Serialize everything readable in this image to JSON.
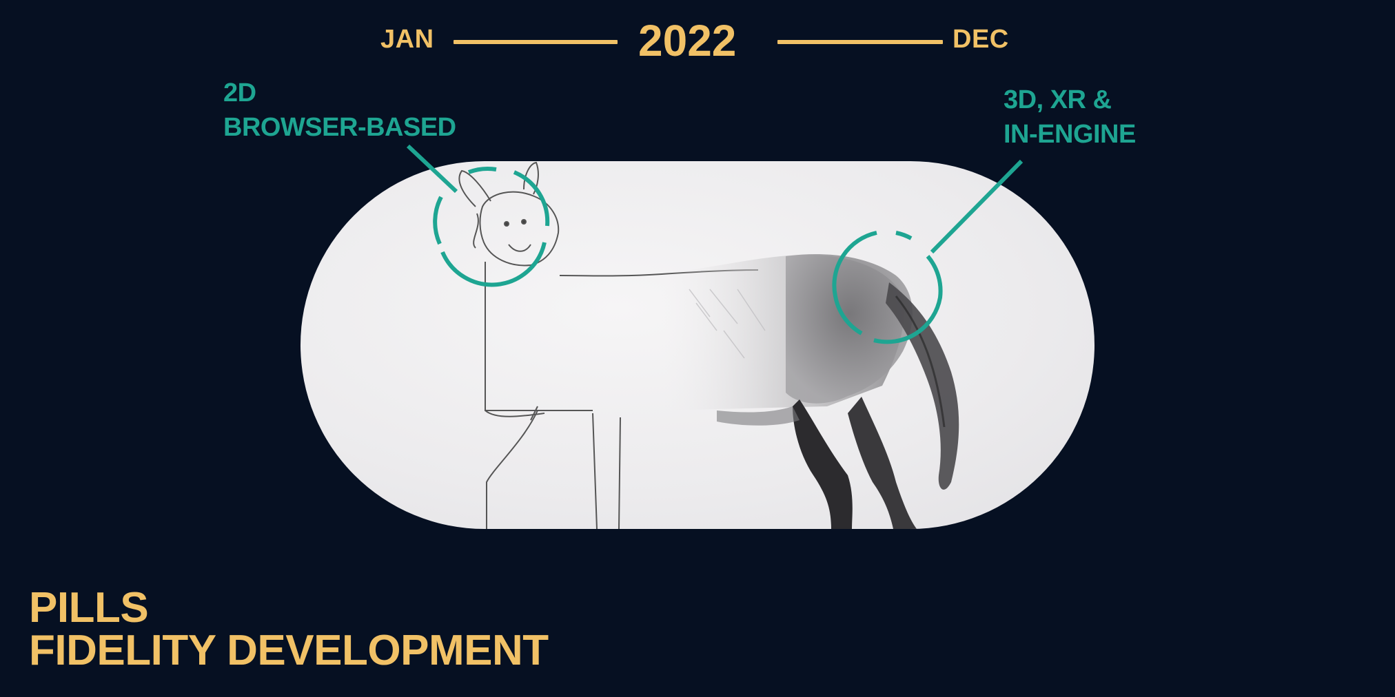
{
  "timeline": {
    "start": "JAN",
    "year": "2022",
    "end": "DEC"
  },
  "callouts": {
    "left": {
      "line1": "2D",
      "line2": "BROWSER-BASED"
    },
    "right": {
      "line1": "3D, XR &",
      "line2": "IN-ENGINE"
    }
  },
  "title": {
    "line1": "PILLS",
    "line2": "FIDELITY DEVELOPMENT"
  },
  "colors": {
    "background": "#061022",
    "accent_yellow": "#f1c166",
    "accent_teal": "#1ea592"
  },
  "image": {
    "subject": "half-sketched, half-detailed horse drawing"
  }
}
